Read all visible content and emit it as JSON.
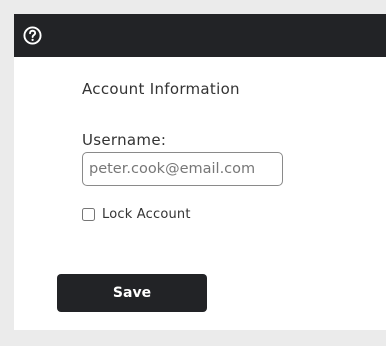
{
  "header": {
    "help_icon": "question-circle-icon"
  },
  "form": {
    "section_title": "Account Information",
    "username_label": "Username:",
    "username_value": "peter.cook@email.com",
    "lock_account_label": "Lock Account",
    "lock_account_checked": false,
    "save_label": "Save"
  },
  "colors": {
    "background": "#ebebeb",
    "panel": "#ffffff",
    "topbar": "#222326",
    "button": "#222326",
    "button_text": "#ffffff"
  }
}
